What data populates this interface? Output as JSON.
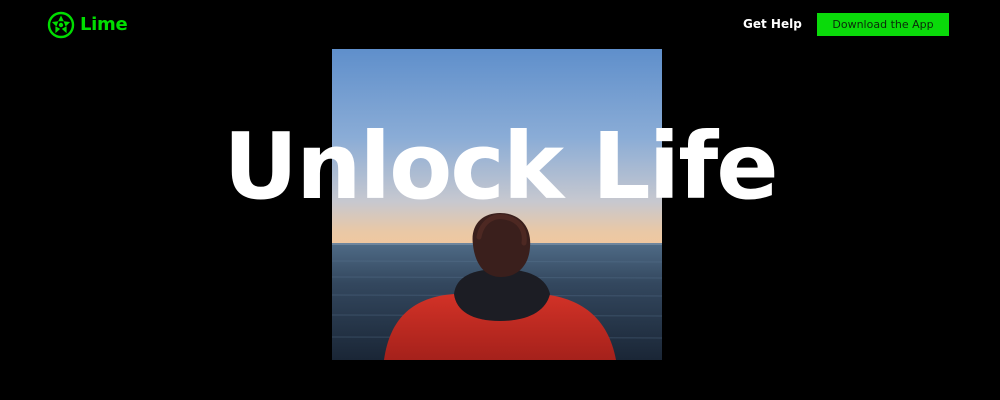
{
  "brand": {
    "name": "Lime",
    "logo_text": "Lime",
    "accent_color": "#0ada0a",
    "logo_icon": "lime-slice-icon"
  },
  "nav": {
    "get_help_label": "Get Help",
    "download_label": "Download the App"
  },
  "hero": {
    "headline": "Unlock Life",
    "photo": "person-in-red-hoodie-facing-ocean"
  }
}
